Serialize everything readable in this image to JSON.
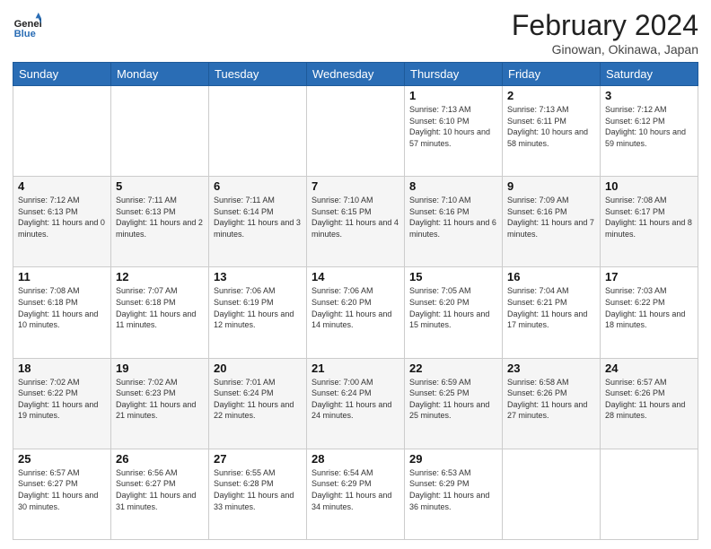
{
  "logo": {
    "line1": "General",
    "line2": "Blue"
  },
  "header": {
    "month": "February 2024",
    "location": "Ginowan, Okinawa, Japan"
  },
  "days_of_week": [
    "Sunday",
    "Monday",
    "Tuesday",
    "Wednesday",
    "Thursday",
    "Friday",
    "Saturday"
  ],
  "weeks": [
    [
      {
        "day": "",
        "info": ""
      },
      {
        "day": "",
        "info": ""
      },
      {
        "day": "",
        "info": ""
      },
      {
        "day": "",
        "info": ""
      },
      {
        "day": "1",
        "info": "Sunrise: 7:13 AM\nSunset: 6:10 PM\nDaylight: 10 hours and 57 minutes."
      },
      {
        "day": "2",
        "info": "Sunrise: 7:13 AM\nSunset: 6:11 PM\nDaylight: 10 hours and 58 minutes."
      },
      {
        "day": "3",
        "info": "Sunrise: 7:12 AM\nSunset: 6:12 PM\nDaylight: 10 hours and 59 minutes."
      }
    ],
    [
      {
        "day": "4",
        "info": "Sunrise: 7:12 AM\nSunset: 6:13 PM\nDaylight: 11 hours and 0 minutes."
      },
      {
        "day": "5",
        "info": "Sunrise: 7:11 AM\nSunset: 6:13 PM\nDaylight: 11 hours and 2 minutes."
      },
      {
        "day": "6",
        "info": "Sunrise: 7:11 AM\nSunset: 6:14 PM\nDaylight: 11 hours and 3 minutes."
      },
      {
        "day": "7",
        "info": "Sunrise: 7:10 AM\nSunset: 6:15 PM\nDaylight: 11 hours and 4 minutes."
      },
      {
        "day": "8",
        "info": "Sunrise: 7:10 AM\nSunset: 6:16 PM\nDaylight: 11 hours and 6 minutes."
      },
      {
        "day": "9",
        "info": "Sunrise: 7:09 AM\nSunset: 6:16 PM\nDaylight: 11 hours and 7 minutes."
      },
      {
        "day": "10",
        "info": "Sunrise: 7:08 AM\nSunset: 6:17 PM\nDaylight: 11 hours and 8 minutes."
      }
    ],
    [
      {
        "day": "11",
        "info": "Sunrise: 7:08 AM\nSunset: 6:18 PM\nDaylight: 11 hours and 10 minutes."
      },
      {
        "day": "12",
        "info": "Sunrise: 7:07 AM\nSunset: 6:18 PM\nDaylight: 11 hours and 11 minutes."
      },
      {
        "day": "13",
        "info": "Sunrise: 7:06 AM\nSunset: 6:19 PM\nDaylight: 11 hours and 12 minutes."
      },
      {
        "day": "14",
        "info": "Sunrise: 7:06 AM\nSunset: 6:20 PM\nDaylight: 11 hours and 14 minutes."
      },
      {
        "day": "15",
        "info": "Sunrise: 7:05 AM\nSunset: 6:20 PM\nDaylight: 11 hours and 15 minutes."
      },
      {
        "day": "16",
        "info": "Sunrise: 7:04 AM\nSunset: 6:21 PM\nDaylight: 11 hours and 17 minutes."
      },
      {
        "day": "17",
        "info": "Sunrise: 7:03 AM\nSunset: 6:22 PM\nDaylight: 11 hours and 18 minutes."
      }
    ],
    [
      {
        "day": "18",
        "info": "Sunrise: 7:02 AM\nSunset: 6:22 PM\nDaylight: 11 hours and 19 minutes."
      },
      {
        "day": "19",
        "info": "Sunrise: 7:02 AM\nSunset: 6:23 PM\nDaylight: 11 hours and 21 minutes."
      },
      {
        "day": "20",
        "info": "Sunrise: 7:01 AM\nSunset: 6:24 PM\nDaylight: 11 hours and 22 minutes."
      },
      {
        "day": "21",
        "info": "Sunrise: 7:00 AM\nSunset: 6:24 PM\nDaylight: 11 hours and 24 minutes."
      },
      {
        "day": "22",
        "info": "Sunrise: 6:59 AM\nSunset: 6:25 PM\nDaylight: 11 hours and 25 minutes."
      },
      {
        "day": "23",
        "info": "Sunrise: 6:58 AM\nSunset: 6:26 PM\nDaylight: 11 hours and 27 minutes."
      },
      {
        "day": "24",
        "info": "Sunrise: 6:57 AM\nSunset: 6:26 PM\nDaylight: 11 hours and 28 minutes."
      }
    ],
    [
      {
        "day": "25",
        "info": "Sunrise: 6:57 AM\nSunset: 6:27 PM\nDaylight: 11 hours and 30 minutes."
      },
      {
        "day": "26",
        "info": "Sunrise: 6:56 AM\nSunset: 6:27 PM\nDaylight: 11 hours and 31 minutes."
      },
      {
        "day": "27",
        "info": "Sunrise: 6:55 AM\nSunset: 6:28 PM\nDaylight: 11 hours and 33 minutes."
      },
      {
        "day": "28",
        "info": "Sunrise: 6:54 AM\nSunset: 6:29 PM\nDaylight: 11 hours and 34 minutes."
      },
      {
        "day": "29",
        "info": "Sunrise: 6:53 AM\nSunset: 6:29 PM\nDaylight: 11 hours and 36 minutes."
      },
      {
        "day": "",
        "info": ""
      },
      {
        "day": "",
        "info": ""
      }
    ]
  ]
}
